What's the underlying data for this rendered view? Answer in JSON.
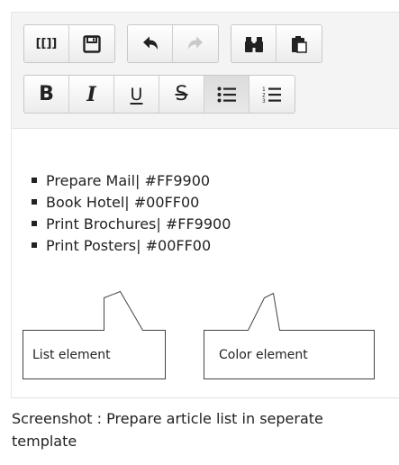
{
  "toolbar": {
    "row1": [
      {
        "name": "wiki-link-button",
        "icon": "wiki-link-icon",
        "text": "[[]]"
      },
      {
        "name": "save-button",
        "icon": "floppy-disk-icon"
      },
      {
        "name": "undo-button",
        "icon": "undo-arrow-icon"
      },
      {
        "name": "redo-button",
        "icon": "redo-arrow-icon"
      },
      {
        "name": "find-button",
        "icon": "binoculars-icon"
      },
      {
        "name": "paste-button",
        "icon": "clipboard-icon"
      }
    ],
    "row2": [
      {
        "name": "bold-button",
        "text": "B"
      },
      {
        "name": "italic-button",
        "text": "I"
      },
      {
        "name": "underline-button",
        "text": "U"
      },
      {
        "name": "strikethrough-button",
        "text": "S"
      },
      {
        "name": "bulleted-list-button",
        "icon": "bulleted-list-icon",
        "active": true
      },
      {
        "name": "numbered-list-button",
        "icon": "numbered-list-icon"
      }
    ]
  },
  "list_items": [
    "Prepare Mail| #FF9900",
    "Book Hotel| #00FF00",
    "Print Brochures| #FF9900",
    "Print Posters| #00FF00"
  ],
  "callouts": {
    "list": "List element",
    "color": "Color element"
  },
  "caption": "Screenshot : Prepare article list in seperate template"
}
